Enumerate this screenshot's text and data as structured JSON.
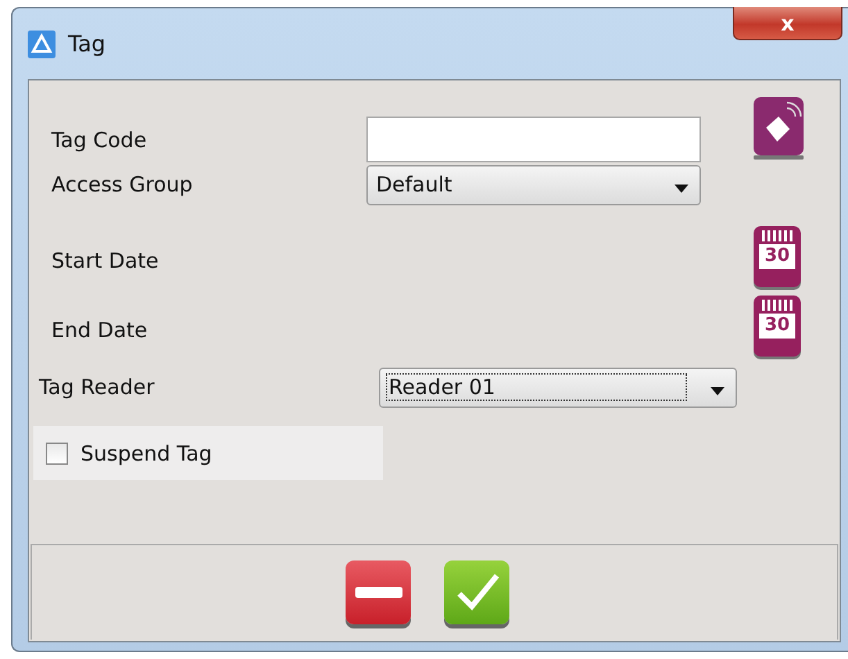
{
  "window": {
    "title": "Tag",
    "close_label": "x"
  },
  "fields": [
    {
      "kind": "text",
      "label": "Tag Code"
    },
    {
      "kind": "select",
      "label": "Access Group",
      "value": "Default"
    },
    {
      "kind": "date",
      "label": "Start Date",
      "day": "30"
    },
    {
      "kind": "date",
      "label": "End Date",
      "day": "30"
    },
    {
      "kind": "select-wide",
      "label": "Tag Reader",
      "value": "Reader 01",
      "focused": true
    }
  ],
  "suspend": {
    "label": "Suspend Tag",
    "checked": false
  },
  "buttons": [
    {
      "kind": "cancel"
    },
    {
      "kind": "confirm"
    }
  ]
}
